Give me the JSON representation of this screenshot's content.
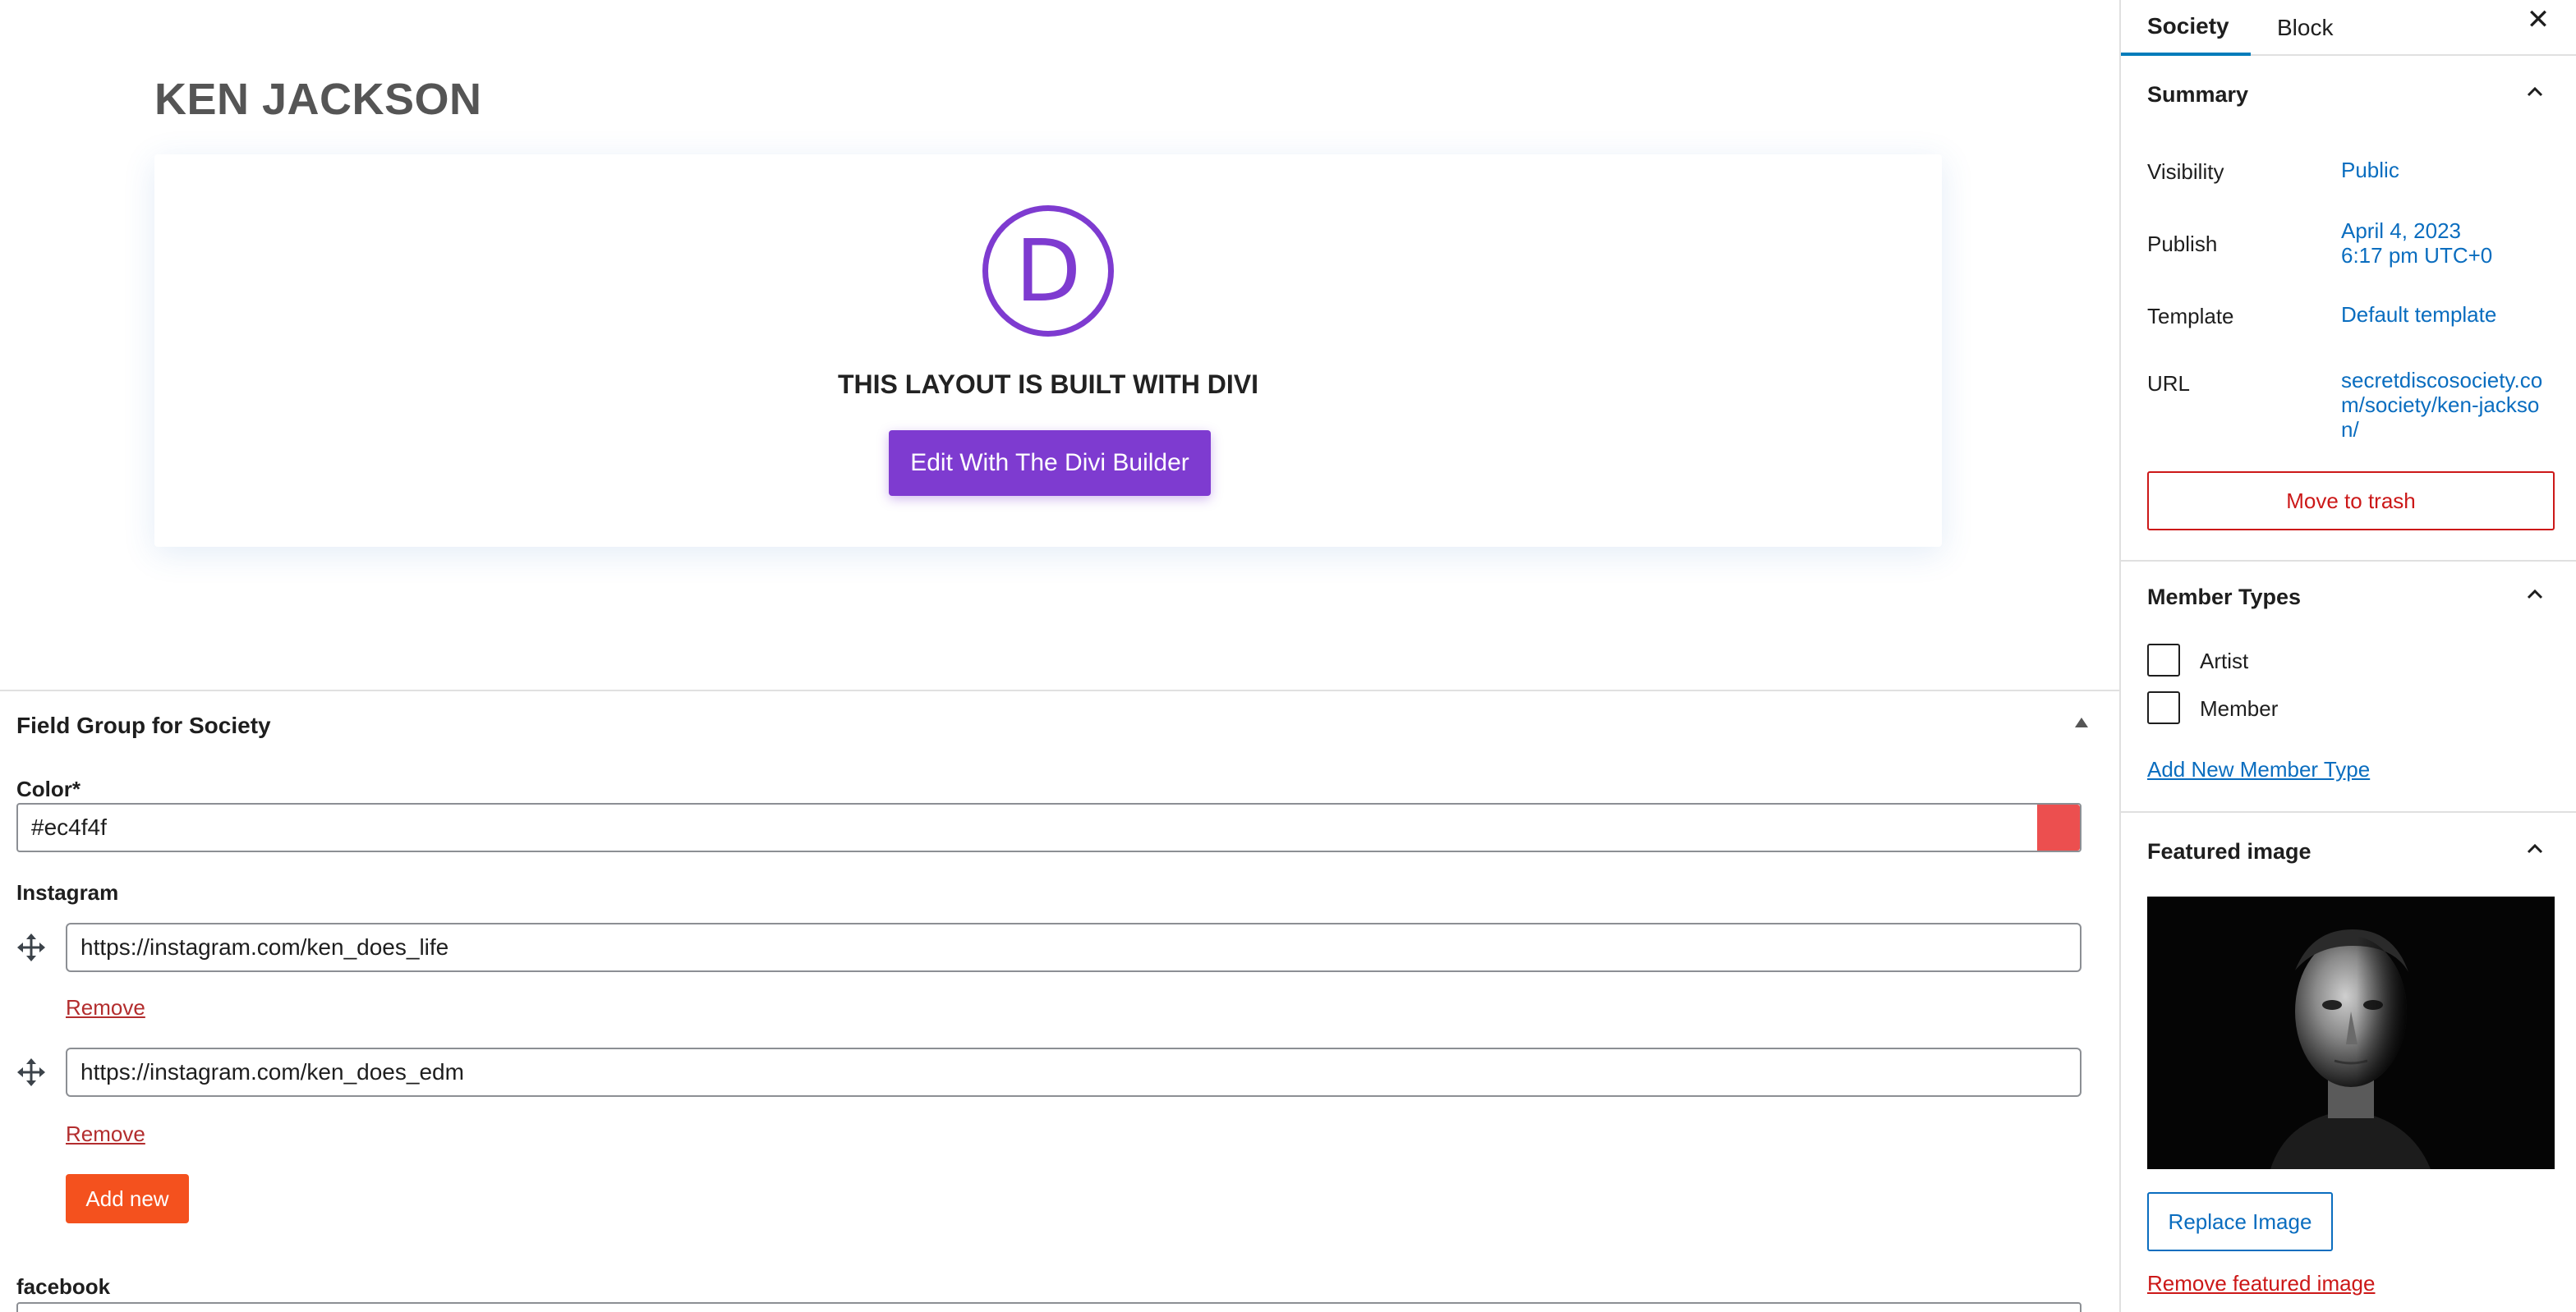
{
  "post": {
    "title": "KEN JACKSON"
  },
  "divi": {
    "logo_letter": "D",
    "message": "THIS LAYOUT IS BUILT WITH DIVI",
    "edit_button": "Edit With The Divi Builder",
    "brand_color": "#7e3bd0"
  },
  "field_group": {
    "title": "Field Group for Society",
    "color_label": "Color*",
    "color_value": "#ec4f4f",
    "instagram_label": "Instagram",
    "instagram_links": [
      {
        "url": "https://instagram.com/ken_does_life",
        "remove_label": "Remove"
      },
      {
        "url": "https://instagram.com/ken_does_edm",
        "remove_label": "Remove"
      }
    ],
    "add_new_label": "Add new",
    "facebook_label": "facebook"
  },
  "sidebar": {
    "tabs": [
      {
        "label": "Society",
        "active": true
      },
      {
        "label": "Block",
        "active": false
      }
    ],
    "summary": {
      "title": "Summary",
      "visibility_label": "Visibility",
      "visibility_value": "Public",
      "publish_label": "Publish",
      "publish_date": "April 4, 2023",
      "publish_time": "6:17 pm UTC+0",
      "template_label": "Template",
      "template_value": "Default template",
      "url_label": "URL",
      "url_value": "secretdiscosociety.com/society/ken-jackson/",
      "trash_label": "Move to trash"
    },
    "member_types": {
      "title": "Member Types",
      "options": [
        {
          "label": "Artist",
          "checked": false
        },
        {
          "label": "Member",
          "checked": false
        }
      ],
      "add_link": "Add New Member Type"
    },
    "featured_image": {
      "title": "Featured image",
      "replace_label": "Replace Image",
      "remove_label": "Remove featured image"
    }
  },
  "colors": {
    "accent": "#007cba",
    "link": "#0a6dbf",
    "danger": "#cc1818",
    "add_new": "#f4511e"
  }
}
